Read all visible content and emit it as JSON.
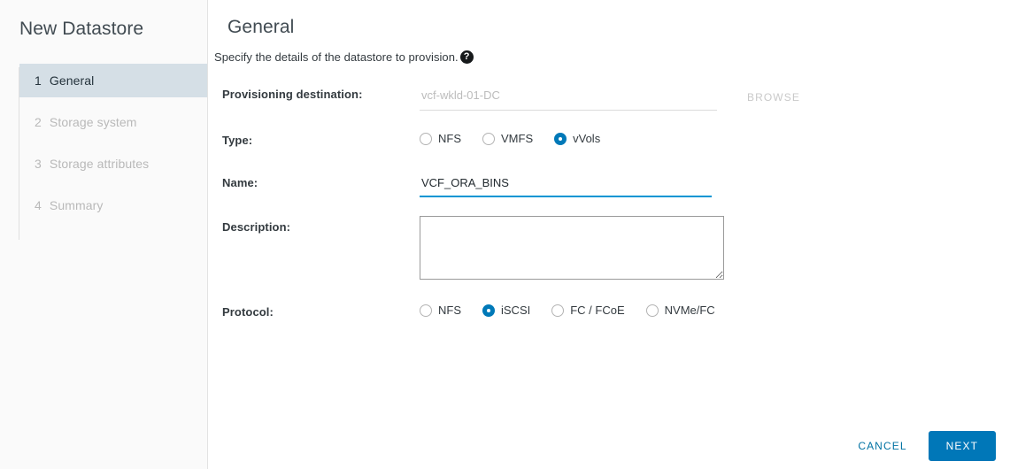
{
  "sidebar": {
    "title": "New Datastore",
    "steps": [
      {
        "num": "1",
        "label": "General",
        "active": true
      },
      {
        "num": "2",
        "label": "Storage system",
        "active": false
      },
      {
        "num": "3",
        "label": "Storage attributes",
        "active": false
      },
      {
        "num": "4",
        "label": "Summary",
        "active": false
      }
    ]
  },
  "main": {
    "page_title": "General",
    "subtitle": "Specify the details of the datastore to provision.",
    "help_icon": "help-circle-icon",
    "help_glyph": "?"
  },
  "form": {
    "destination": {
      "label": "Provisioning destination:",
      "value": "",
      "placeholder": "vcf-wkld-01-DC",
      "browse_label": "BROWSE"
    },
    "type": {
      "label": "Type:",
      "options": [
        {
          "label": "NFS",
          "checked": false
        },
        {
          "label": "VMFS",
          "checked": false
        },
        {
          "label": "vVols",
          "checked": true
        }
      ]
    },
    "name": {
      "label": "Name:",
      "value": "VCF_ORA_BINS",
      "placeholder": ""
    },
    "description": {
      "label": "Description:",
      "value": "",
      "placeholder": ""
    },
    "protocol": {
      "label": "Protocol:",
      "options": [
        {
          "label": "NFS",
          "checked": false
        },
        {
          "label": "iSCSI",
          "checked": true
        },
        {
          "label": "FC / FCoE",
          "checked": false
        },
        {
          "label": "NVMe/FC",
          "checked": false
        }
      ]
    }
  },
  "footer": {
    "cancel_label": "CANCEL",
    "next_label": "NEXT"
  },
  "colors": {
    "accent": "#0077b8",
    "focus_underline": "#0095d3",
    "step_active_bg": "#d5dfe6",
    "link": "#0072a3"
  }
}
